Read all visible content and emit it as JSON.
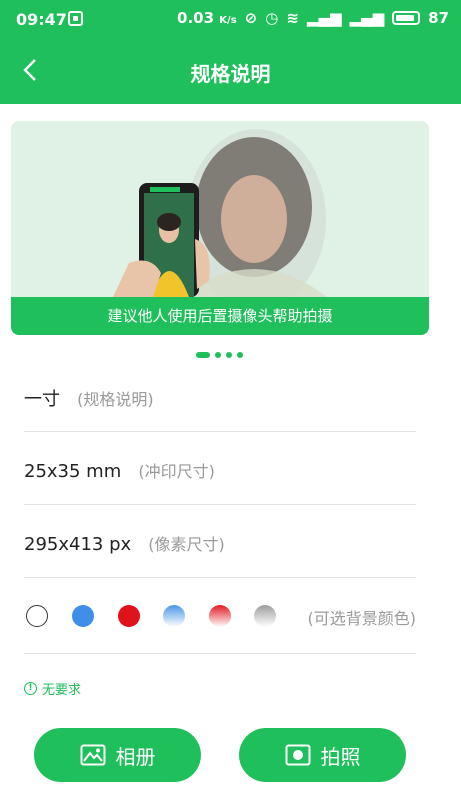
{
  "status_bar": {
    "time": "09:47",
    "speed": "0.03",
    "speed_unit": "K/s",
    "battery": "87"
  },
  "nav": {
    "title": "规格说明"
  },
  "banner": {
    "caption": "建议他人使用后置摄像头帮助拍摄"
  },
  "specs": [
    {
      "value": "一寸",
      "label": "(规格说明)"
    },
    {
      "value": "25x35 mm",
      "label": "(冲印尺寸)"
    },
    {
      "value": "295x413 px",
      "label": "(像素尺寸)"
    }
  ],
  "colors": {
    "label": "(可选背景颜色)",
    "swatches": [
      "white",
      "blue",
      "red",
      "blue-gradient",
      "red-gradient",
      "gray-gradient"
    ]
  },
  "requirement": {
    "text": "无要求"
  },
  "buttons": {
    "album": "相册",
    "shoot": "拍照"
  },
  "theme": {
    "accent": "#1fbf5b"
  }
}
